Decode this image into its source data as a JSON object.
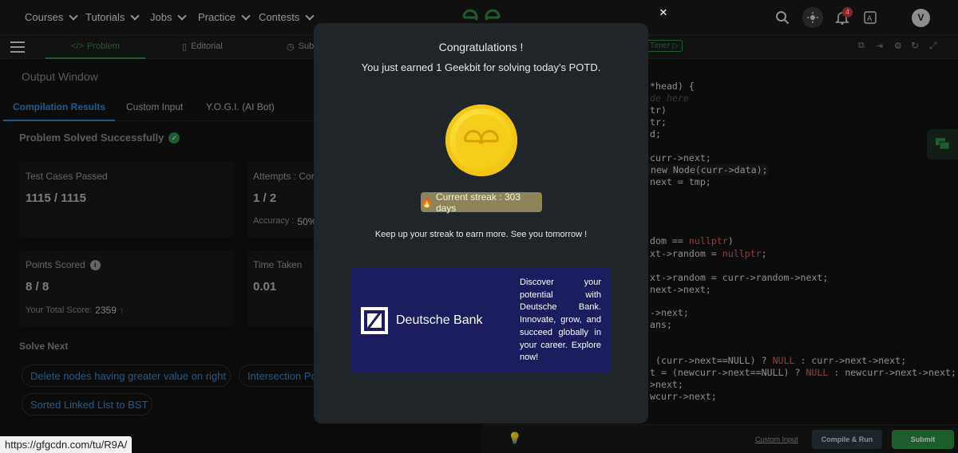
{
  "nav": {
    "items": [
      "Courses",
      "Tutorials",
      "Jobs",
      "Practice",
      "Contests"
    ],
    "notification_count": "4",
    "avatar_initial": "V"
  },
  "tabs": {
    "problem": "Problem",
    "editorial": "Editorial",
    "submissions": "Subm",
    "timer": "Timer"
  },
  "output": {
    "title": "Output Window",
    "tabs": [
      "Compilation Results",
      "Custom Input",
      "Y.O.G.I. (AI Bot)"
    ],
    "solved_text": "Problem Solved Successfully",
    "test_cases_label": "Test Cases Passed",
    "test_cases_value": "1115 / 1115",
    "attempts_label": "Attempts : Cor",
    "attempts_value": "1 / 2",
    "accuracy_label": "Accuracy :",
    "accuracy_value": "50%",
    "points_label": "Points Scored",
    "points_value": "8 / 8",
    "total_score_label": "Your Total Score:",
    "total_score_value": "2359",
    "time_label": "Time Taken",
    "time_value": "0.01",
    "solve_next_title": "Solve Next",
    "solve_next": [
      "Delete nodes having greater value on right",
      "Intersection Po",
      "Sorted Linked List to BST"
    ]
  },
  "code_lines": [
    {
      "plain": "*head) {"
    },
    {
      "comment": "de here"
    },
    {
      "plain": "tr)"
    },
    {
      "plain": "tr;"
    },
    {
      "plain": "d;"
    },
    {
      "plain": "curr->next;"
    },
    {
      "plain": " new Node(curr->data);"
    },
    {
      "plain": "next = tmp;"
    },
    {
      "pre": "dom == ",
      "red": "nullptr",
      "post": ")"
    },
    {
      "pre": "xt->random = ",
      "red": "nullptr",
      "post": ";"
    },
    {
      "plain": "xt->random = curr->random->next;"
    },
    {
      "plain": "next->next;"
    },
    {
      "plain": "->next;"
    },
    {
      "plain": "ans;"
    },
    {
      "pre": " (curr->next==NULL) ? ",
      "red": "NULL",
      "post": " : curr->next->next;"
    },
    {
      "pre": "t = (newcurr->next==NULL) ? ",
      "red": "NULL",
      "post": " : newcurr->next->next;"
    },
    {
      "plain": ">next;"
    },
    {
      "plain": "wcurr->next;"
    }
  ],
  "bottom_bar": {
    "custom_input": "Custom Input",
    "compile_run": "Compile & Run",
    "submit": "Submit"
  },
  "modal": {
    "title": "Congratulations !",
    "subtitle": "You just earned 1 Geekbit for solving today's POTD.",
    "streak_icon": "fire-icon",
    "streak_text": "Current streak : 303 days",
    "encouragement": "Keep up your streak to earn more. See you tomorrow !",
    "ad_brand": "Deutsche Bank",
    "ad_text": "Discover your potential with Deutsche Bank. Innovate, grow, and succeed globally in your career. Explore now!",
    "close_label": "✕"
  },
  "status_url": "https://gfgcdn.com/tu/R9A/",
  "colors": {
    "accent_green": "#2f8d46",
    "link_blue": "#2f8bd6",
    "modal_bg": "#20252a",
    "ad_bg": "#1b1d5e",
    "streak_bg": "#8c855a"
  }
}
